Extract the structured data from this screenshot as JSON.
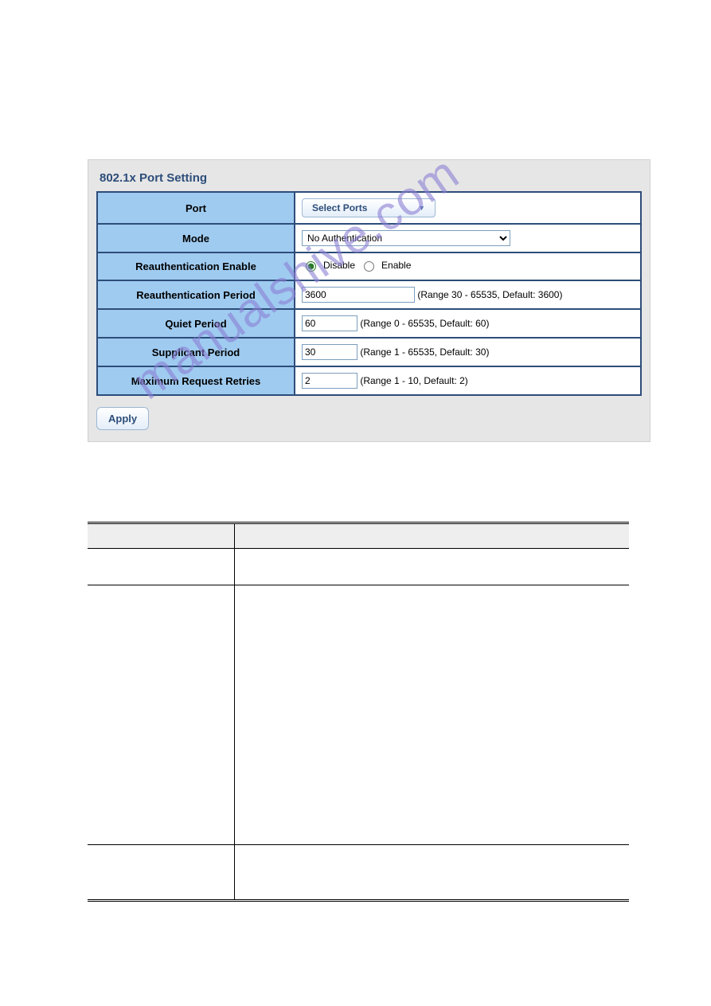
{
  "watermark": "manualshive.com",
  "panel": {
    "title": "802.1x Port Setting",
    "port_label": "Port",
    "port_select_btn": "Select Ports",
    "mode_label": "Mode",
    "mode_options": [
      "No Authentication"
    ],
    "mode_value": "No Authentication",
    "reauth_enable_label": "Reauthentication Enable",
    "disable_label": "Disable",
    "enable_label": "Enable",
    "reauth_period_label": "Reauthentication Period",
    "reauth_period_value": "3600",
    "reauth_period_note": "(Range 30 - 65535, Default: 3600)",
    "quiet_label": "Quiet Period",
    "quiet_value": "60",
    "quiet_note": "(Range 0 - 65535, Default: 60)",
    "supplicant_label": "Supplicant Period",
    "supplicant_value": "30",
    "supplicant_note": "(Range 1 - 65535, Default: 30)",
    "max_retries_label": "Maximum Request Retries",
    "max_retries_value": "2",
    "max_retries_note": "(Range 1 - 10, Default: 2)",
    "apply_label": "Apply"
  }
}
